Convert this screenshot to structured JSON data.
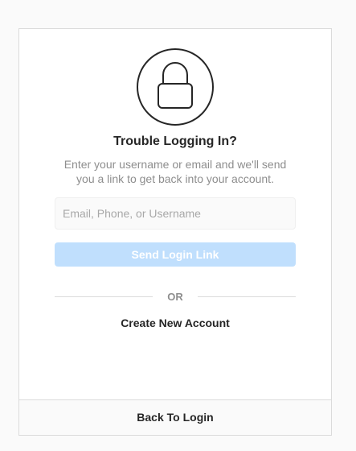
{
  "reset": {
    "icon": "lock-icon",
    "title": "Trouble Logging In?",
    "description": "Enter your username or email and we'll send you a link to get back into your account.",
    "input": {
      "value": "",
      "placeholder": "Email, Phone, or Username"
    },
    "send_button_label": "Send Login Link",
    "divider_label": "OR",
    "create_account_label": "Create New Account",
    "back_to_login_label": "Back To Login"
  },
  "colors": {
    "page_background": "#fafafa",
    "card_border": "#dbdbdb",
    "button_disabled": "#c0dffd",
    "text_primary": "#262626",
    "text_secondary": "#8e8e8e"
  }
}
